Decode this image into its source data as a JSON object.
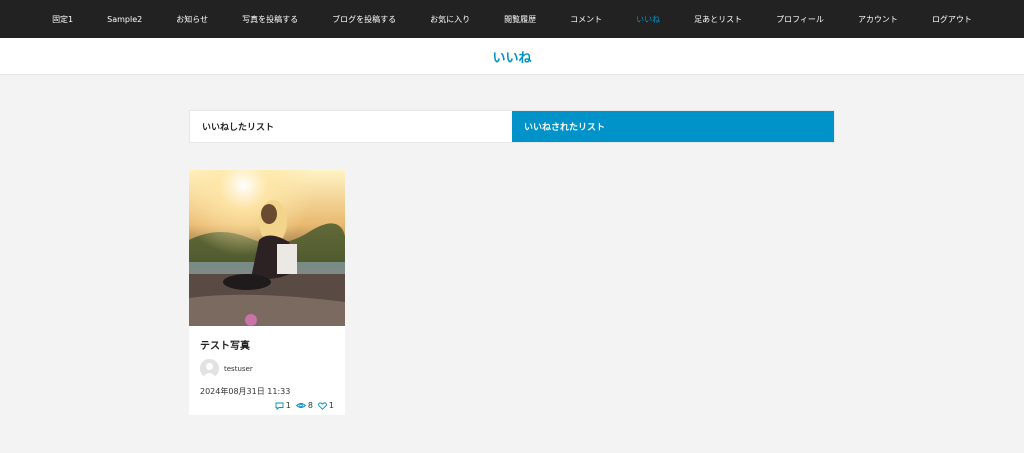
{
  "nav": {
    "items": [
      "固定1",
      "Sample2",
      "お知らせ",
      "写真を投稿する",
      "ブログを投稿する",
      "お気に入り",
      "閲覧履歴",
      "コメント",
      "いいね",
      "足あとリスト",
      "プロフィール",
      "アカウント",
      "ログアウト"
    ],
    "active_index": 8
  },
  "page": {
    "title": "いいね"
  },
  "tabs": [
    {
      "label": "いいねしたリスト",
      "active": false
    },
    {
      "label": "いいねされたリスト",
      "active": true
    }
  ],
  "card": {
    "title": "テスト写真",
    "author": "testuser",
    "date": "2024年08月31日 11:33",
    "comments": "1",
    "views": "8",
    "likes": "1"
  },
  "colors": {
    "accent": "#0093c9",
    "nav_bg": "#222222"
  },
  "icons": {
    "comment": "comment-icon",
    "views": "eye-icon",
    "likes": "heart-icon"
  }
}
